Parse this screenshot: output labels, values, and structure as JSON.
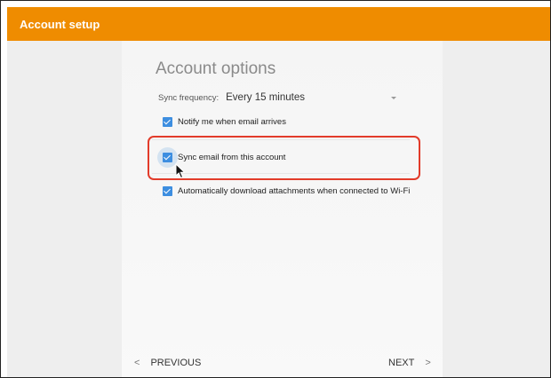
{
  "appbar": {
    "title": "Account setup"
  },
  "panel": {
    "title": "Account options",
    "sync_frequency": {
      "label": "Sync frequency:",
      "value": "Every 15 minutes"
    },
    "options": [
      {
        "label": "Notify me when email arrives",
        "checked": true
      },
      {
        "label": "Sync email from this account",
        "checked": true
      },
      {
        "label": "Automatically download attachments when connected to Wi-Fi",
        "checked": true
      }
    ]
  },
  "nav": {
    "previous_label": "PREVIOUS",
    "next_label": "NEXT"
  },
  "icons": {
    "prev_glyph": "<",
    "next_glyph": ">"
  },
  "colors": {
    "appbar": "#ef8c00",
    "checkbox": "#3d8ee0",
    "highlight": "#e23b2a"
  }
}
